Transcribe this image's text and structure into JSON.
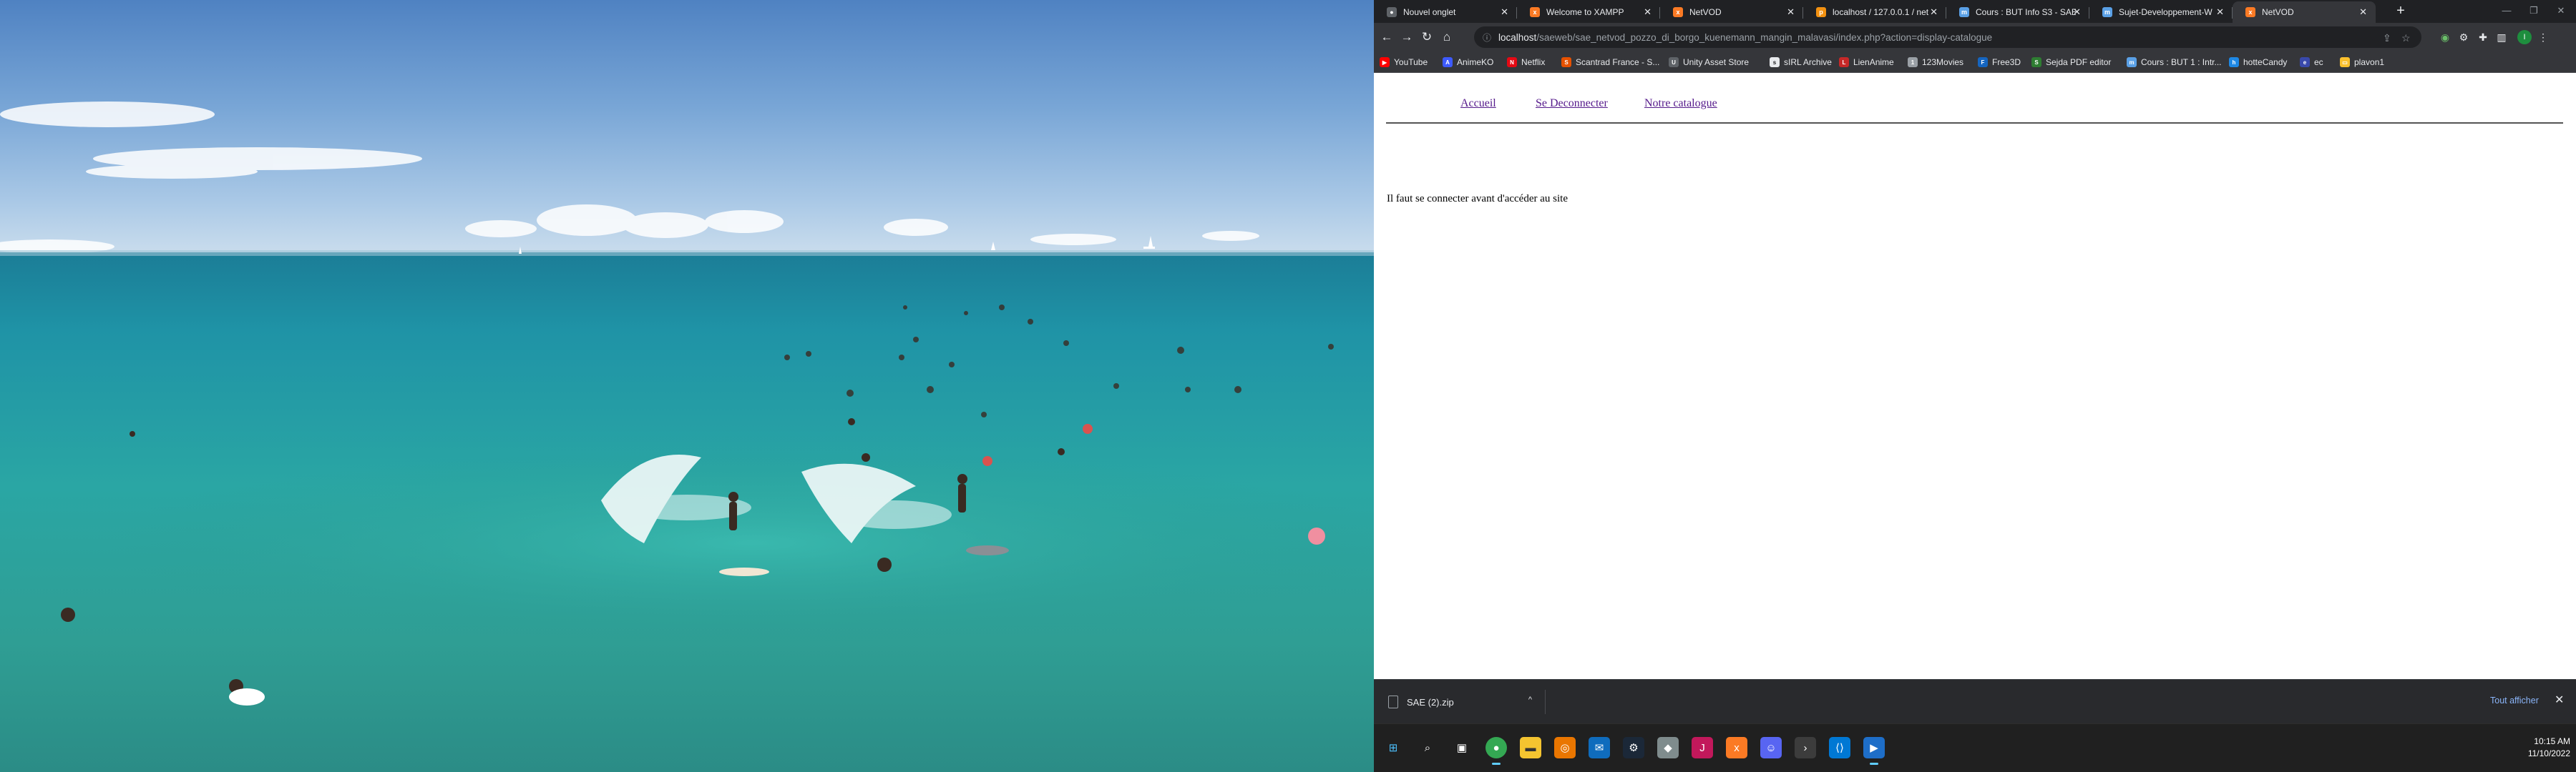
{
  "browser": {
    "tabs": [
      {
        "label": "Nouvel onglet",
        "favicon": "chrome-icon",
        "color": "#5f6368",
        "active": false
      },
      {
        "label": "Welcome to XAMPP",
        "favicon": "xampp-icon",
        "color": "#fb7a24",
        "active": false
      },
      {
        "label": "NetVOD",
        "favicon": "xampp-icon",
        "color": "#fb7a24",
        "active": false
      },
      {
        "label": "localhost / 127.0.0.1 / net",
        "favicon": "phpmyadmin-icon",
        "color": "#f29111",
        "active": false
      },
      {
        "label": "Cours : BUT Info S3 - SAE",
        "favicon": "moodle-icon",
        "color": "#5aa0e6",
        "active": false
      },
      {
        "label": "Sujet-Developpement-W",
        "favicon": "moodle-icon",
        "color": "#5aa0e6",
        "active": false
      },
      {
        "label": "NetVOD",
        "favicon": "xampp-icon",
        "color": "#fb7a24",
        "active": true
      }
    ],
    "url_host": "localhost",
    "url_rest": "/saeweb/sae_netvod_pozzo_di_borgo_kuenemann_mangin_malavasi/index.php?action=display-catalogue",
    "bookmarks": [
      {
        "label": "YouTube",
        "icon": "youtube-icon",
        "color": "#ff0000"
      },
      {
        "label": "AnimeKO",
        "icon": "animeko-icon",
        "color": "#3d5afe"
      },
      {
        "label": "Netflix",
        "icon": "netflix-icon",
        "color": "#e50914"
      },
      {
        "label": "Scantrad France - S...",
        "icon": "scantrad-icon",
        "color": "#e65100"
      },
      {
        "label": "Unity Asset Store",
        "icon": "unity-icon",
        "color": "#5f6368"
      },
      {
        "label": "sIRL Archive",
        "icon": "archive-icon",
        "color": "#e8eaed"
      },
      {
        "label": "LienAnime",
        "icon": "lienanime-icon",
        "color": "#c62828"
      },
      {
        "label": "123Movies",
        "icon": "movies-icon",
        "color": "#9aa0a6"
      },
      {
        "label": "Free3D",
        "icon": "free3d-icon",
        "color": "#1565c0"
      },
      {
        "label": "Sejda PDF editor",
        "icon": "sejda-icon",
        "color": "#2e7d32"
      },
      {
        "label": "Cours : BUT 1 : Intr...",
        "icon": "moodle-icon",
        "color": "#5aa0e6"
      },
      {
        "label": "hotteCandy",
        "icon": "hottecandy-icon",
        "color": "#1e88e5"
      },
      {
        "label": "ec",
        "icon": "ec-icon",
        "color": "#3949ab"
      },
      {
        "label": "plavon1",
        "icon": "folder-icon",
        "color": "#fbc02d"
      }
    ]
  },
  "page": {
    "nav": [
      "Accueil",
      "Se Deconnecter",
      "Notre catalogue"
    ],
    "message": "Il faut se connecter avant d'accéder au site"
  },
  "downloads": {
    "filename": "SAE (2).zip",
    "show_all": "Tout afficher"
  },
  "taskbar": {
    "time": "10:15 AM",
    "date": "11/10/2022",
    "apps": [
      {
        "icon": "windows-start-icon",
        "color": "#0078d4"
      },
      {
        "icon": "search-icon",
        "color": "#202020"
      },
      {
        "icon": "task-view-icon",
        "color": "#202020"
      },
      {
        "icon": "chrome-icon",
        "color": "#34a853"
      },
      {
        "icon": "file-explorer-icon",
        "color": "#f4c430"
      },
      {
        "icon": "blender-icon",
        "color": "#ea7600"
      },
      {
        "icon": "mail-icon",
        "color": "#0f6cbd"
      },
      {
        "icon": "steam-icon",
        "color": "#1b2838"
      },
      {
        "icon": "app-icon",
        "color": "#7f8c8d"
      },
      {
        "icon": "jetbrains-icon",
        "color": "#c2185b"
      },
      {
        "icon": "xampp-icon",
        "color": "#fb7a24"
      },
      {
        "icon": "discord-icon",
        "color": "#5865f2"
      },
      {
        "icon": "terminal-icon",
        "color": "#3c3c3c"
      },
      {
        "icon": "vscode-icon",
        "color": "#0078d4"
      },
      {
        "icon": "media-icon",
        "color": "#1e6ec8"
      }
    ]
  }
}
